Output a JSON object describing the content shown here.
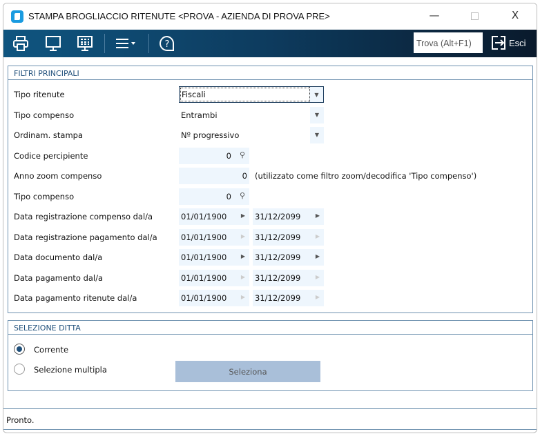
{
  "window": {
    "title": "STAMPA BROGLIACCIO RITENUTE <PROVA - AZIENDA DI PROVA PRE>",
    "minimize": "—",
    "close": "X"
  },
  "toolbar": {
    "find_placeholder": "Trova (Alt+F1)",
    "exit_label": "Esci"
  },
  "filters": {
    "title": "FILTRI PRINCIPALI",
    "tipo_ritenute": {
      "label": "Tipo ritenute",
      "value": "Fiscali"
    },
    "tipo_compenso": {
      "label": "Tipo compenso",
      "value": "Entrambi"
    },
    "ordinamento": {
      "label": "Ordinam. stampa",
      "value": "Nº progressivo"
    },
    "codice_percipiente": {
      "label": "Codice percipiente",
      "value": "0"
    },
    "anno_zoom": {
      "label": "Anno zoom compenso",
      "value": "0",
      "note": "(utilizzato come filtro zoom/decodifica 'Tipo compenso')"
    },
    "tipo_compenso_code": {
      "label": "Tipo compenso",
      "value": "0"
    },
    "date_rows": [
      {
        "label": "Data registrazione compenso dal/a",
        "from": "01/01/1900",
        "to": "31/12/2099",
        "enabled": true
      },
      {
        "label": "Data registrazione pagamento dal/a",
        "from": "01/01/1900",
        "to": "31/12/2099",
        "enabled": false
      },
      {
        "label": "Data documento dal/a",
        "from": "01/01/1900",
        "to": "31/12/2099",
        "enabled": true
      },
      {
        "label": "Data pagamento dal/a",
        "from": "01/01/1900",
        "to": "31/12/2099",
        "enabled": false
      },
      {
        "label": "Data pagamento ritenute dal/a",
        "from": "01/01/1900",
        "to": "31/12/2099",
        "enabled": false
      }
    ]
  },
  "company": {
    "title": "SELEZIONE DITTA",
    "current": "Corrente",
    "multiple": "Selezione multipla",
    "select_button": "Seleziona"
  },
  "status": {
    "text": "Pronto."
  }
}
